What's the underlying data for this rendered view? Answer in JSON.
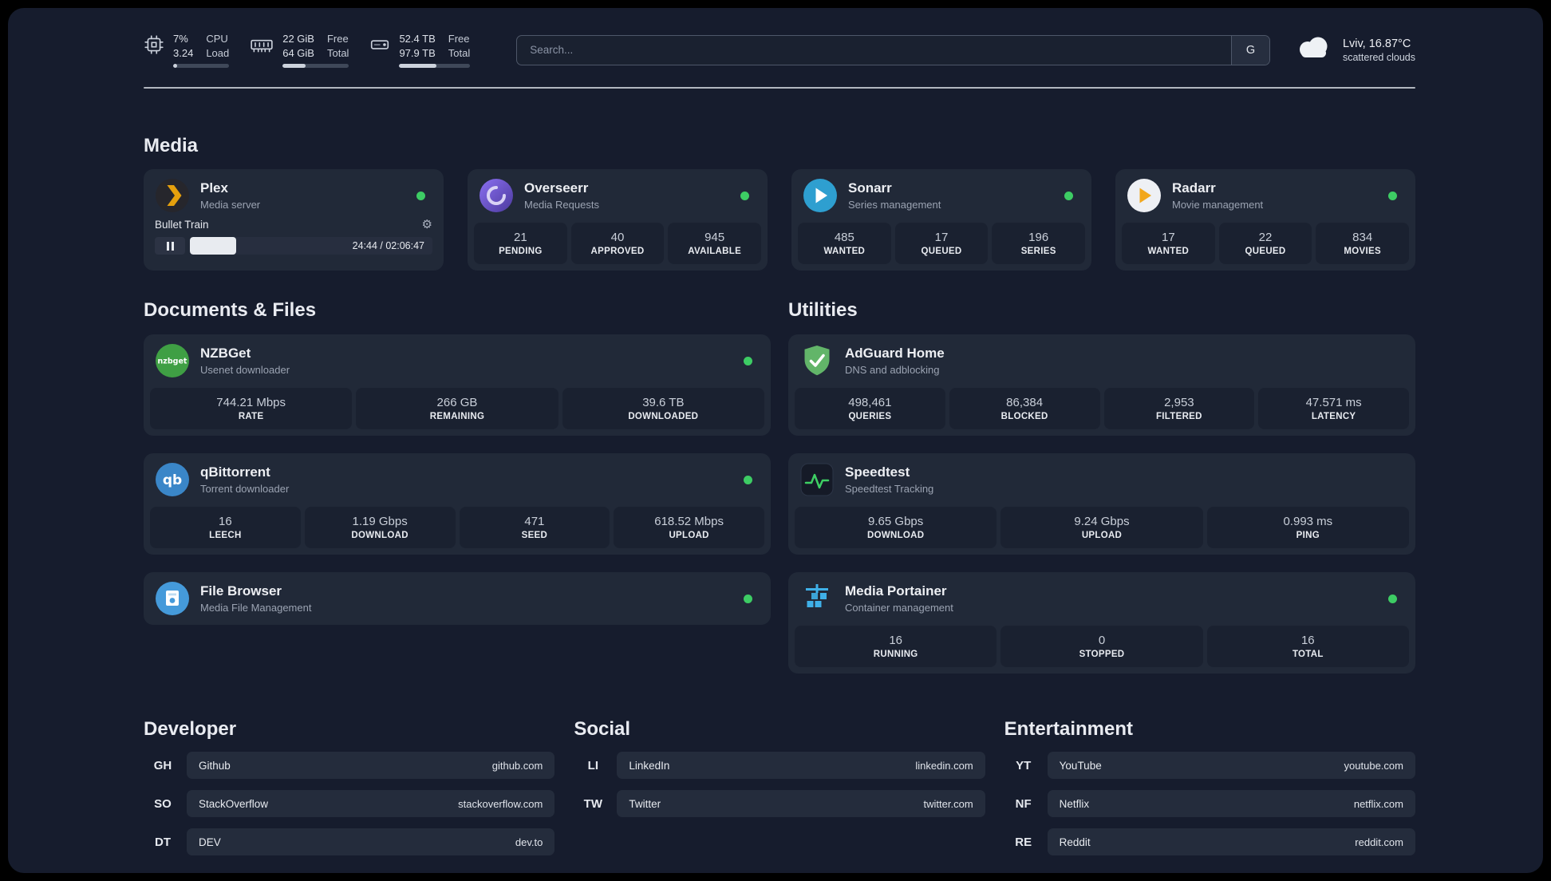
{
  "colors": {
    "page_bg": "#161c2d",
    "card_bg": "#212938",
    "tile_bg": "#1a2130",
    "bar_bg": "#242c3c",
    "green": "#3dcc64",
    "divider": "#ccd1d9",
    "plex_accent": "#e5a00d"
  },
  "glyphs": {
    "gear": "⚙"
  },
  "header": {
    "cpu": {
      "value_top": "7%",
      "value_bottom": "3.24",
      "label_top": "CPU",
      "label_bottom": "Load",
      "progress": 7
    },
    "memory": {
      "value_top": "22 GiB",
      "value_bottom": "64 GiB",
      "label_top": "Free",
      "label_bottom": "Total",
      "progress": 34
    },
    "disk": {
      "value_top": "52.4 TB",
      "value_bottom": "97.9 TB",
      "label_top": "Free",
      "label_bottom": "Total",
      "progress": 53
    },
    "search": {
      "placeholder": "Search...",
      "engine": "G"
    },
    "weather": {
      "location": "Lviv, 16.87°C",
      "condition": "scattered clouds"
    }
  },
  "media": {
    "heading": "Media",
    "plex": {
      "title": "Plex",
      "subtitle": "Media server",
      "now_playing": "Bullet Train",
      "time": "24:44 / 02:06:47",
      "progress": 19
    },
    "overseerr": {
      "title": "Overseerr",
      "subtitle": "Media Requests",
      "stats": [
        {
          "value": "21",
          "label": "PENDING"
        },
        {
          "value": "40",
          "label": "APPROVED"
        },
        {
          "value": "945",
          "label": "AVAILABLE"
        }
      ]
    },
    "sonarr": {
      "title": "Sonarr",
      "subtitle": "Series management",
      "stats": [
        {
          "value": "485",
          "label": "WANTED"
        },
        {
          "value": "17",
          "label": "QUEUED"
        },
        {
          "value": "196",
          "label": "SERIES"
        }
      ]
    },
    "radarr": {
      "title": "Radarr",
      "subtitle": "Movie management",
      "stats": [
        {
          "value": "17",
          "label": "WANTED"
        },
        {
          "value": "22",
          "label": "QUEUED"
        },
        {
          "value": "834",
          "label": "MOVIES"
        }
      ]
    }
  },
  "documents": {
    "heading": "Documents & Files",
    "nzbget": {
      "title": "NZBGet",
      "subtitle": "Usenet downloader",
      "stats": [
        {
          "value": "744.21 Mbps",
          "label": "RATE"
        },
        {
          "value": "266 GB",
          "label": "REMAINING"
        },
        {
          "value": "39.6 TB",
          "label": "DOWNLOADED"
        }
      ]
    },
    "qbittorrent": {
      "title": "qBittorrent",
      "subtitle": "Torrent downloader",
      "stats": [
        {
          "value": "16",
          "label": "LEECH"
        },
        {
          "value": "1.19 Gbps",
          "label": "DOWNLOAD"
        },
        {
          "value": "471",
          "label": "SEED"
        },
        {
          "value": "618.52 Mbps",
          "label": "UPLOAD"
        }
      ]
    },
    "filebrowser": {
      "title": "File Browser",
      "subtitle": "Media File Management"
    }
  },
  "utilities": {
    "heading": "Utilities",
    "adguard": {
      "title": "AdGuard Home",
      "subtitle": "DNS and adblocking",
      "stats": [
        {
          "value": "498,461",
          "label": "QUERIES"
        },
        {
          "value": "86,384",
          "label": "BLOCKED"
        },
        {
          "value": "2,953",
          "label": "FILTERED"
        },
        {
          "value": "47.571 ms",
          "label": "LATENCY"
        }
      ]
    },
    "speedtest": {
      "title": "Speedtest",
      "subtitle": "Speedtest Tracking",
      "stats": [
        {
          "value": "9.65 Gbps",
          "label": "DOWNLOAD"
        },
        {
          "value": "9.24 Gbps",
          "label": "UPLOAD"
        },
        {
          "value": "0.993 ms",
          "label": "PING"
        }
      ]
    },
    "portainer": {
      "title": "Media Portainer",
      "subtitle": "Container management",
      "stats": [
        {
          "value": "16",
          "label": "RUNNING"
        },
        {
          "value": "0",
          "label": "STOPPED"
        },
        {
          "value": "16",
          "label": "TOTAL"
        }
      ]
    }
  },
  "bookmarks": {
    "developer": {
      "heading": "Developer",
      "items": [
        {
          "abbr": "GH",
          "name": "Github",
          "url": "github.com"
        },
        {
          "abbr": "SO",
          "name": "StackOverflow",
          "url": "stackoverflow.com"
        },
        {
          "abbr": "DT",
          "name": "DEV",
          "url": "dev.to"
        }
      ]
    },
    "social": {
      "heading": "Social",
      "items": [
        {
          "abbr": "LI",
          "name": "LinkedIn",
          "url": "linkedin.com"
        },
        {
          "abbr": "TW",
          "name": "Twitter",
          "url": "twitter.com"
        }
      ]
    },
    "entertainment": {
      "heading": "Entertainment",
      "items": [
        {
          "abbr": "YT",
          "name": "YouTube",
          "url": "youtube.com"
        },
        {
          "abbr": "NF",
          "name": "Netflix",
          "url": "netflix.com"
        },
        {
          "abbr": "RE",
          "name": "Reddit",
          "url": "reddit.com"
        }
      ]
    }
  }
}
